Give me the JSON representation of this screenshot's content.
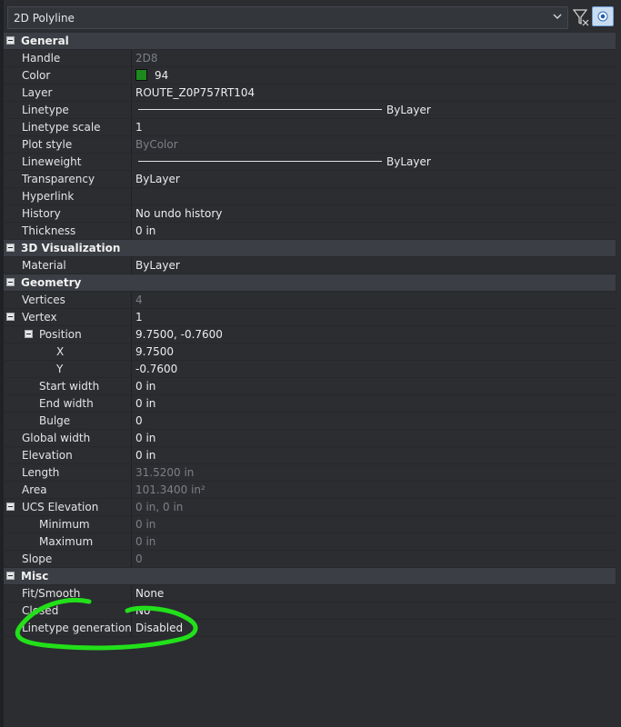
{
  "header": {
    "object_type": "2D Polyline",
    "chevron_icon": "chevron-down-icon",
    "filter_icon": "filter-icon",
    "quick_select_icon": "quick-select-icon"
  },
  "categories": {
    "general": "General",
    "visualization": "3D Visualization",
    "geometry": "Geometry",
    "misc": "Misc"
  },
  "general": {
    "handle_label": "Handle",
    "handle_value": "2D8",
    "color_label": "Color",
    "color_value": "94",
    "color_hex": "#1e8a1e",
    "layer_label": "Layer",
    "layer_value": "ROUTE_Z0P757RT104",
    "linetype_label": "Linetype",
    "linetype_value": "ByLayer",
    "linetype_scale_label": "Linetype scale",
    "linetype_scale_value": "1",
    "plot_style_label": "Plot style",
    "plot_style_value": "ByColor",
    "lineweight_label": "Lineweight",
    "lineweight_value": "ByLayer",
    "transparency_label": "Transparency",
    "transparency_value": "ByLayer",
    "hyperlink_label": "Hyperlink",
    "hyperlink_value": "",
    "history_label": "History",
    "history_value": "No undo history",
    "thickness_label": "Thickness",
    "thickness_value": "0 in"
  },
  "visualization": {
    "material_label": "Material",
    "material_value": "ByLayer"
  },
  "geometry": {
    "vertices_label": "Vertices",
    "vertices_value": "4",
    "vertex_label": "Vertex",
    "vertex_value": "1",
    "position_label": "Position",
    "position_value": "9.7500, -0.7600",
    "x_label": "X",
    "x_value": "9.7500",
    "y_label": "Y",
    "y_value": "-0.7600",
    "start_width_label": "Start width",
    "start_width_value": "0 in",
    "end_width_label": "End width",
    "end_width_value": "0 in",
    "bulge_label": "Bulge",
    "bulge_value": "0",
    "global_width_label": "Global width",
    "global_width_value": "0 in",
    "elevation_label": "Elevation",
    "elevation_value": "0 in",
    "length_label": "Length",
    "length_value": "31.5200 in",
    "area_label": "Area",
    "area_value": "101.3400 in²",
    "ucs_elevation_label": "UCS Elevation",
    "ucs_elevation_value": "0 in, 0 in",
    "minimum_label": "Minimum",
    "minimum_value": "0 in",
    "maximum_label": "Maximum",
    "maximum_value": "0 in",
    "slope_label": "Slope",
    "slope_value": "0"
  },
  "misc": {
    "fit_smooth_label": "Fit/Smooth",
    "fit_smooth_value": "None",
    "closed_label": "Closed",
    "closed_value": "No",
    "linetype_generation_label": "Linetype generation",
    "linetype_generation_value": "Disabled"
  },
  "annotation": {
    "highlight_color": "#22e01a"
  }
}
